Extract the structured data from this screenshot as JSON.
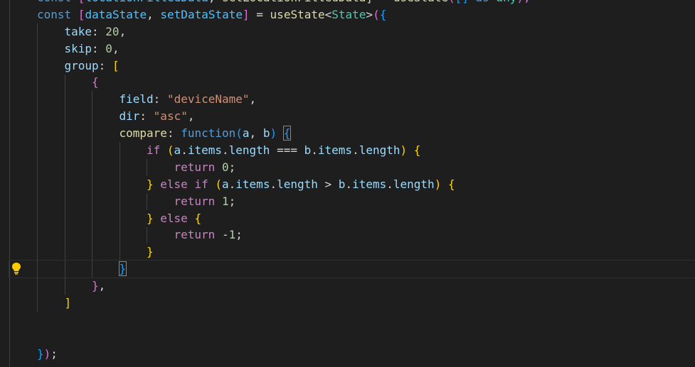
{
  "editor": {
    "lines": [
      {
        "id": "l0",
        "indent": 0,
        "tokens": [
          {
            "t": "const ",
            "c": "kw"
          },
          {
            "t": "[",
            "c": "b2"
          },
          {
            "t": "locationFilledData",
            "c": "cst"
          },
          {
            "t": ", ",
            "c": "pun"
          },
          {
            "t": "setLocationFilledData",
            "c": "fn"
          },
          {
            "t": "] = ",
            "c": "pun"
          },
          {
            "t": "useState",
            "c": "fn"
          },
          {
            "t": "(",
            "c": "b2"
          },
          {
            "t": "[",
            "c": "b3"
          },
          {
            "t": "] ",
            "c": "b3"
          },
          {
            "t": "as ",
            "c": "kw"
          },
          {
            "t": "any",
            "c": "type"
          },
          {
            "t": ");",
            "c": "b2"
          }
        ]
      },
      {
        "id": "l1",
        "indent": 0,
        "tokens": [
          {
            "t": "const ",
            "c": "kw"
          },
          {
            "t": "[",
            "c": "b2"
          },
          {
            "t": "dataState",
            "c": "cst"
          },
          {
            "t": ", ",
            "c": "pun"
          },
          {
            "t": "setDataState",
            "c": "cst"
          },
          {
            "t": "]",
            "c": "b2"
          },
          {
            "t": " = ",
            "c": "pun"
          },
          {
            "t": "useState",
            "c": "fn"
          },
          {
            "t": "<",
            "c": "pun"
          },
          {
            "t": "State",
            "c": "type"
          },
          {
            "t": ">",
            "c": "pun"
          },
          {
            "t": "(",
            "c": "b2"
          },
          {
            "t": "{",
            "c": "b3"
          }
        ]
      },
      {
        "id": "l2",
        "indent": 1,
        "tokens": [
          {
            "t": "take",
            "c": "var"
          },
          {
            "t": ": ",
            "c": "pun"
          },
          {
            "t": "20",
            "c": "num"
          },
          {
            "t": ",",
            "c": "pun"
          }
        ]
      },
      {
        "id": "l3",
        "indent": 1,
        "tokens": [
          {
            "t": "skip",
            "c": "var"
          },
          {
            "t": ": ",
            "c": "pun"
          },
          {
            "t": "0",
            "c": "num"
          },
          {
            "t": ",",
            "c": "pun"
          }
        ]
      },
      {
        "id": "l4",
        "indent": 1,
        "tokens": [
          {
            "t": "group",
            "c": "var"
          },
          {
            "t": ": ",
            "c": "pun"
          },
          {
            "t": "[",
            "c": "b1"
          }
        ]
      },
      {
        "id": "l5",
        "indent": 2,
        "tokens": [
          {
            "t": "{",
            "c": "b2"
          }
        ]
      },
      {
        "id": "l6",
        "indent": 3,
        "tokens": [
          {
            "t": "field",
            "c": "var"
          },
          {
            "t": ": ",
            "c": "pun"
          },
          {
            "t": "\"deviceName\"",
            "c": "str"
          },
          {
            "t": ",",
            "c": "pun"
          }
        ]
      },
      {
        "id": "l7",
        "indent": 3,
        "tokens": [
          {
            "t": "dir",
            "c": "var"
          },
          {
            "t": ": ",
            "c": "pun"
          },
          {
            "t": "\"asc\"",
            "c": "str"
          },
          {
            "t": ",",
            "c": "pun"
          }
        ]
      },
      {
        "id": "l8",
        "indent": 3,
        "tokens": [
          {
            "t": "compare",
            "c": "fn"
          },
          {
            "t": ": ",
            "c": "pun"
          },
          {
            "t": "function",
            "c": "kw"
          },
          {
            "t": "(",
            "c": "b3"
          },
          {
            "t": "a",
            "c": "var"
          },
          {
            "t": ", ",
            "c": "pun"
          },
          {
            "t": "b",
            "c": "var"
          },
          {
            "t": ")",
            "c": "b3"
          },
          {
            "t": " ",
            "c": "pun"
          },
          {
            "t": "{",
            "c": "b3",
            "box": true
          }
        ]
      },
      {
        "id": "l9",
        "indent": 4,
        "tokens": [
          {
            "t": "if ",
            "c": "ctl"
          },
          {
            "t": "(",
            "c": "b1"
          },
          {
            "t": "a",
            "c": "var"
          },
          {
            "t": ".",
            "c": "pun"
          },
          {
            "t": "items",
            "c": "var"
          },
          {
            "t": ".",
            "c": "pun"
          },
          {
            "t": "length",
            "c": "var"
          },
          {
            "t": " === ",
            "c": "pun"
          },
          {
            "t": "b",
            "c": "var"
          },
          {
            "t": ".",
            "c": "pun"
          },
          {
            "t": "items",
            "c": "var"
          },
          {
            "t": ".",
            "c": "pun"
          },
          {
            "t": "length",
            "c": "var"
          },
          {
            "t": ")",
            "c": "b1"
          },
          {
            "t": " ",
            "c": "pun"
          },
          {
            "t": "{",
            "c": "b1"
          }
        ]
      },
      {
        "id": "l10",
        "indent": 5,
        "tokens": [
          {
            "t": "return ",
            "c": "ctl"
          },
          {
            "t": "0",
            "c": "num"
          },
          {
            "t": ";",
            "c": "pun"
          }
        ]
      },
      {
        "id": "l11",
        "indent": 4,
        "tokens": [
          {
            "t": "}",
            "c": "b1"
          },
          {
            "t": " ",
            "c": "pun"
          },
          {
            "t": "else ",
            "c": "ctl"
          },
          {
            "t": "if ",
            "c": "ctl"
          },
          {
            "t": "(",
            "c": "b1"
          },
          {
            "t": "a",
            "c": "var"
          },
          {
            "t": ".",
            "c": "pun"
          },
          {
            "t": "items",
            "c": "var"
          },
          {
            "t": ".",
            "c": "pun"
          },
          {
            "t": "length",
            "c": "var"
          },
          {
            "t": " > ",
            "c": "pun"
          },
          {
            "t": "b",
            "c": "var"
          },
          {
            "t": ".",
            "c": "pun"
          },
          {
            "t": "items",
            "c": "var"
          },
          {
            "t": ".",
            "c": "pun"
          },
          {
            "t": "length",
            "c": "var"
          },
          {
            "t": ")",
            "c": "b1"
          },
          {
            "t": " ",
            "c": "pun"
          },
          {
            "t": "{",
            "c": "b1"
          }
        ]
      },
      {
        "id": "l12",
        "indent": 5,
        "tokens": [
          {
            "t": "return ",
            "c": "ctl"
          },
          {
            "t": "1",
            "c": "num"
          },
          {
            "t": ";",
            "c": "pun"
          }
        ]
      },
      {
        "id": "l13",
        "indent": 4,
        "tokens": [
          {
            "t": "}",
            "c": "b1"
          },
          {
            "t": " ",
            "c": "pun"
          },
          {
            "t": "else ",
            "c": "ctl"
          },
          {
            "t": "{",
            "c": "b1"
          }
        ]
      },
      {
        "id": "l14",
        "indent": 5,
        "tokens": [
          {
            "t": "return ",
            "c": "ctl"
          },
          {
            "t": "-",
            "c": "pun"
          },
          {
            "t": "1",
            "c": "num"
          },
          {
            "t": ";",
            "c": "pun"
          }
        ]
      },
      {
        "id": "l15",
        "indent": 4,
        "tokens": [
          {
            "t": "}",
            "c": "b1"
          }
        ]
      },
      {
        "id": "l16",
        "indent": 3,
        "current": true,
        "tokens": [
          {
            "t": "}",
            "c": "b3",
            "box": true
          }
        ]
      },
      {
        "id": "l17",
        "indent": 2,
        "tokens": [
          {
            "t": "}",
            "c": "b2"
          },
          {
            "t": ",",
            "c": "pun"
          }
        ]
      },
      {
        "id": "l18",
        "indent": 1,
        "tokens": [
          {
            "t": "]",
            "c": "b1"
          }
        ]
      },
      {
        "id": "l19",
        "indent": 0,
        "tokens": []
      },
      {
        "id": "l20",
        "indent": 0,
        "tokens": []
      },
      {
        "id": "l21",
        "indent": 0,
        "tokens": [
          {
            "t": "}",
            "c": "b3"
          },
          {
            "t": ")",
            "c": "b2"
          },
          {
            "t": ";",
            "c": "pun"
          }
        ]
      }
    ],
    "lightbulb_icon": "lightbulb-icon",
    "colors": {
      "background": "#1e1e1e",
      "keyword": "#569cd6",
      "control": "#c586c0",
      "variable": "#9cdcfe",
      "function": "#dcdcaa",
      "type": "#4ec9b0",
      "number": "#b5cea8",
      "string": "#ce9178",
      "bracket_gold": "#ffd700",
      "bracket_orchid": "#da70d6",
      "bracket_blue": "#179fff",
      "lightbulb": "#ffcc00"
    }
  }
}
